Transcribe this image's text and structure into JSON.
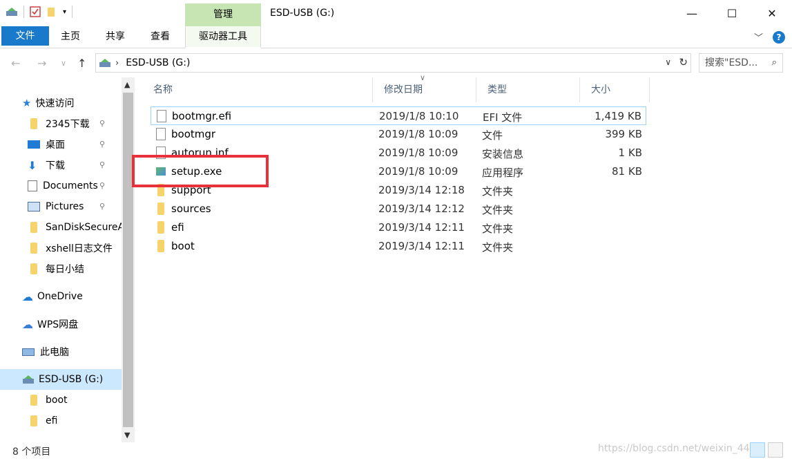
{
  "window": {
    "title": "ESD-USB (G:)",
    "manage_label": "管理",
    "minimize": "—",
    "maximize": "☐",
    "close": "✕"
  },
  "ribbon": {
    "tabs": [
      "文件",
      "主页",
      "共享",
      "查看",
      "驱动器工具"
    ],
    "expand_icon": "chevron-down-icon",
    "help_label": "?"
  },
  "address": {
    "path": "ESD-USB (G:)",
    "search_placeholder": "搜索\"ESD..."
  },
  "nav": {
    "items": [
      {
        "label": "快速访问",
        "icon": "star-icon"
      },
      {
        "label": "2345下载",
        "icon": "folder-icon",
        "pinned": true
      },
      {
        "label": "桌面",
        "icon": "desktop-icon",
        "pinned": true
      },
      {
        "label": "下载",
        "icon": "download-icon",
        "pinned": true
      },
      {
        "label": "Documents",
        "icon": "documents-icon",
        "pinned": true
      },
      {
        "label": "Pictures",
        "icon": "pictures-icon",
        "pinned": true
      },
      {
        "label": "SanDiskSecureA",
        "icon": "folder-icon"
      },
      {
        "label": "xshell日志文件",
        "icon": "folder-icon"
      },
      {
        "label": "每日小结",
        "icon": "folder-icon"
      },
      {
        "label": "OneDrive",
        "icon": "cloud-icon"
      },
      {
        "label": "WPS网盘",
        "icon": "cloud-icon"
      },
      {
        "label": "此电脑",
        "icon": "computer-icon"
      },
      {
        "label": "ESD-USB (G:)",
        "icon": "usb-drive-icon"
      },
      {
        "label": "boot",
        "icon": "folder-icon"
      },
      {
        "label": "efi",
        "icon": "folder-icon"
      }
    ]
  },
  "columns": [
    "名称",
    "修改日期",
    "类型",
    "大小"
  ],
  "files": [
    {
      "name": "bootmgr.efi",
      "date": "2019/1/8 10:10",
      "type": "EFI 文件",
      "size": "1,419 KB",
      "icon": "file-icon"
    },
    {
      "name": "bootmgr",
      "date": "2019/1/8 10:09",
      "type": "文件",
      "size": "399 KB",
      "icon": "file-icon"
    },
    {
      "name": "autorun.inf",
      "date": "2019/1/8 10:09",
      "type": "安装信息",
      "size": "1 KB",
      "icon": "file-icon"
    },
    {
      "name": "setup.exe",
      "date": "2019/1/8 10:09",
      "type": "应用程序",
      "size": "81 KB",
      "icon": "exe-icon"
    },
    {
      "name": "support",
      "date": "2019/3/14 12:18",
      "type": "文件夹",
      "size": "",
      "icon": "folder-icon"
    },
    {
      "name": "sources",
      "date": "2019/3/14 12:12",
      "type": "文件夹",
      "size": "",
      "icon": "folder-icon"
    },
    {
      "name": "efi",
      "date": "2019/3/14 12:11",
      "type": "文件夹",
      "size": "",
      "icon": "folder-icon"
    },
    {
      "name": "boot",
      "date": "2019/3/14 12:11",
      "type": "文件夹",
      "size": "",
      "icon": "folder-icon"
    }
  ],
  "status": {
    "count": "8 个项目",
    "watermark": "https://blog.csdn.net/weixin_4458"
  },
  "colors": {
    "file_tab": "#1979ca",
    "manage_tab": "#c6e5b3",
    "highlight_box": "#e8313a",
    "selected_nav": "#cce8ff"
  }
}
